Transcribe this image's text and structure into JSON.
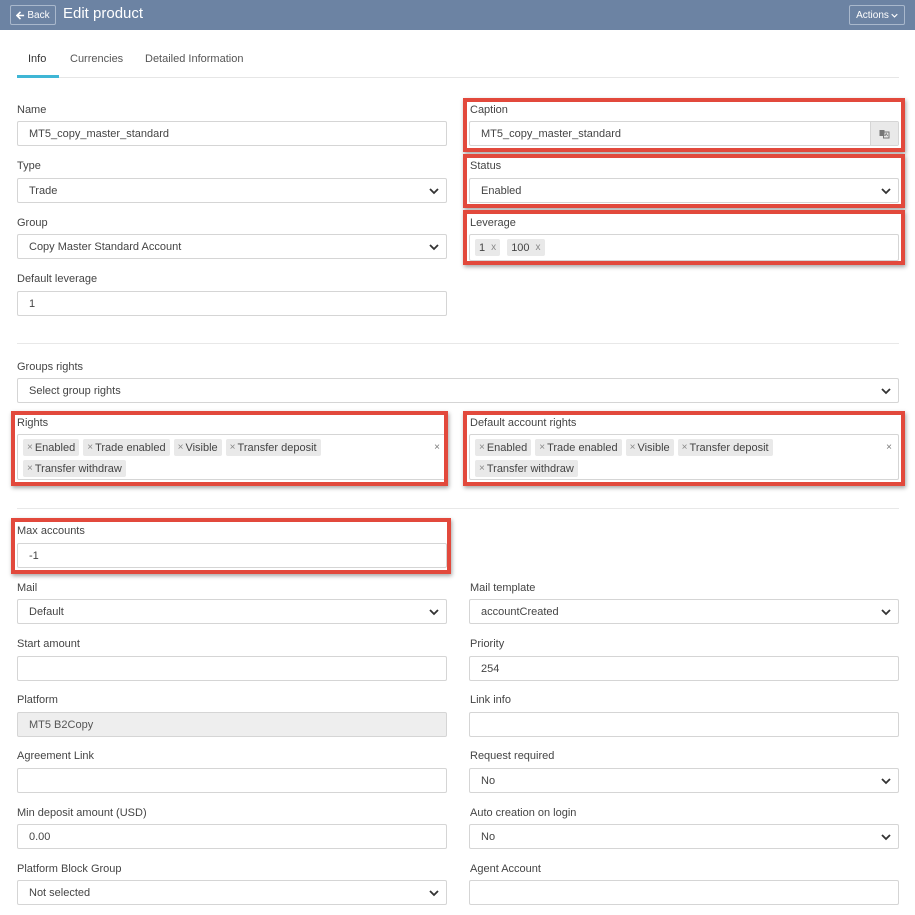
{
  "header": {
    "back_label": "Back",
    "title": "Edit product",
    "actions_label": "Actions"
  },
  "tabs": [
    {
      "label": "Info",
      "active": true
    },
    {
      "label": "Currencies",
      "active": false
    },
    {
      "label": "Detailed Information",
      "active": false
    }
  ],
  "form": {
    "name": {
      "label": "Name",
      "value": "MT5_copy_master_standard"
    },
    "caption": {
      "label": "Caption",
      "value": "MT5_copy_master_standard"
    },
    "type": {
      "label": "Type",
      "value": "Trade"
    },
    "status": {
      "label": "Status",
      "value": "Enabled"
    },
    "group": {
      "label": "Group",
      "value": "Copy Master Standard Account"
    },
    "leverage": {
      "label": "Leverage",
      "values": [
        "1",
        "100"
      ]
    },
    "default_leverage": {
      "label": "Default leverage",
      "value": "1"
    },
    "groups_rights": {
      "label": "Groups rights",
      "value": "Select group rights"
    },
    "rights": {
      "label": "Rights",
      "values": [
        "Enabled",
        "Trade enabled",
        "Visible",
        "Transfer deposit",
        "Transfer withdraw"
      ]
    },
    "default_account_rights": {
      "label": "Default account rights",
      "values": [
        "Enabled",
        "Trade enabled",
        "Visible",
        "Transfer deposit",
        "Transfer withdraw"
      ]
    },
    "max_accounts": {
      "label": "Max accounts",
      "value": "-1"
    },
    "mail": {
      "label": "Mail",
      "value": "Default"
    },
    "mail_template": {
      "label": "Mail template",
      "value": "accountCreated"
    },
    "start_amount": {
      "label": "Start amount",
      "value": ""
    },
    "priority": {
      "label": "Priority",
      "value": "254"
    },
    "platform": {
      "label": "Platform",
      "value": "MT5 B2Copy"
    },
    "link_info": {
      "label": "Link info",
      "value": ""
    },
    "agreement_link": {
      "label": "Agreement Link",
      "value": ""
    },
    "request_required": {
      "label": "Request required",
      "value": "No"
    },
    "min_deposit": {
      "label": "Min deposit amount (USD)",
      "value": "0.00"
    },
    "auto_creation": {
      "label": "Auto creation on login",
      "value": "No"
    },
    "platform_block_group": {
      "label": "Platform Block Group",
      "value": "Not selected"
    },
    "agent_account": {
      "label": "Agent Account",
      "value": ""
    }
  },
  "colors": {
    "header_bg": "#6c83a3",
    "tab_accent": "#3fb6d5",
    "highlight": "#e2493c"
  }
}
